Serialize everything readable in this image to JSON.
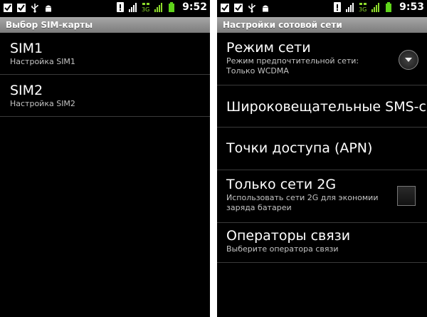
{
  "left": {
    "status_time": "9:52",
    "title": "Выбор SIM-карты",
    "items": [
      {
        "title": "SIM1",
        "summary": "Настройка SIM1"
      },
      {
        "title": "SIM2",
        "summary": "Настройка SIM2"
      }
    ]
  },
  "right": {
    "status_time": "9:53",
    "title": "Настройки сотовой сети",
    "network_mode": {
      "title": "Режим сети",
      "summary_line1": "Режим предпочтительной сети:",
      "summary_line2": "Только WCDMA"
    },
    "broadcast_sms": {
      "title": "Широковещательные SMS-с"
    },
    "apn": {
      "title": "Точки доступа (APN)"
    },
    "only_2g": {
      "title": "Только сети 2G",
      "summary_line1": "Использовать сети 2G для экономии",
      "summary_line2": "заряда батареи",
      "checked": false
    },
    "operators": {
      "title": "Операторы связи",
      "summary": "Выберите оператора связи"
    }
  },
  "icons": {
    "status_left": [
      "check-box-icon",
      "check-box-icon",
      "usb-icon",
      "android-icon"
    ],
    "status_right": [
      "alert-icon",
      "signal-icon",
      "3g-data-icon",
      "signal-icon",
      "battery-icon"
    ],
    "signal_color": "#8edb2c",
    "battery_color": "#5fd41b"
  }
}
